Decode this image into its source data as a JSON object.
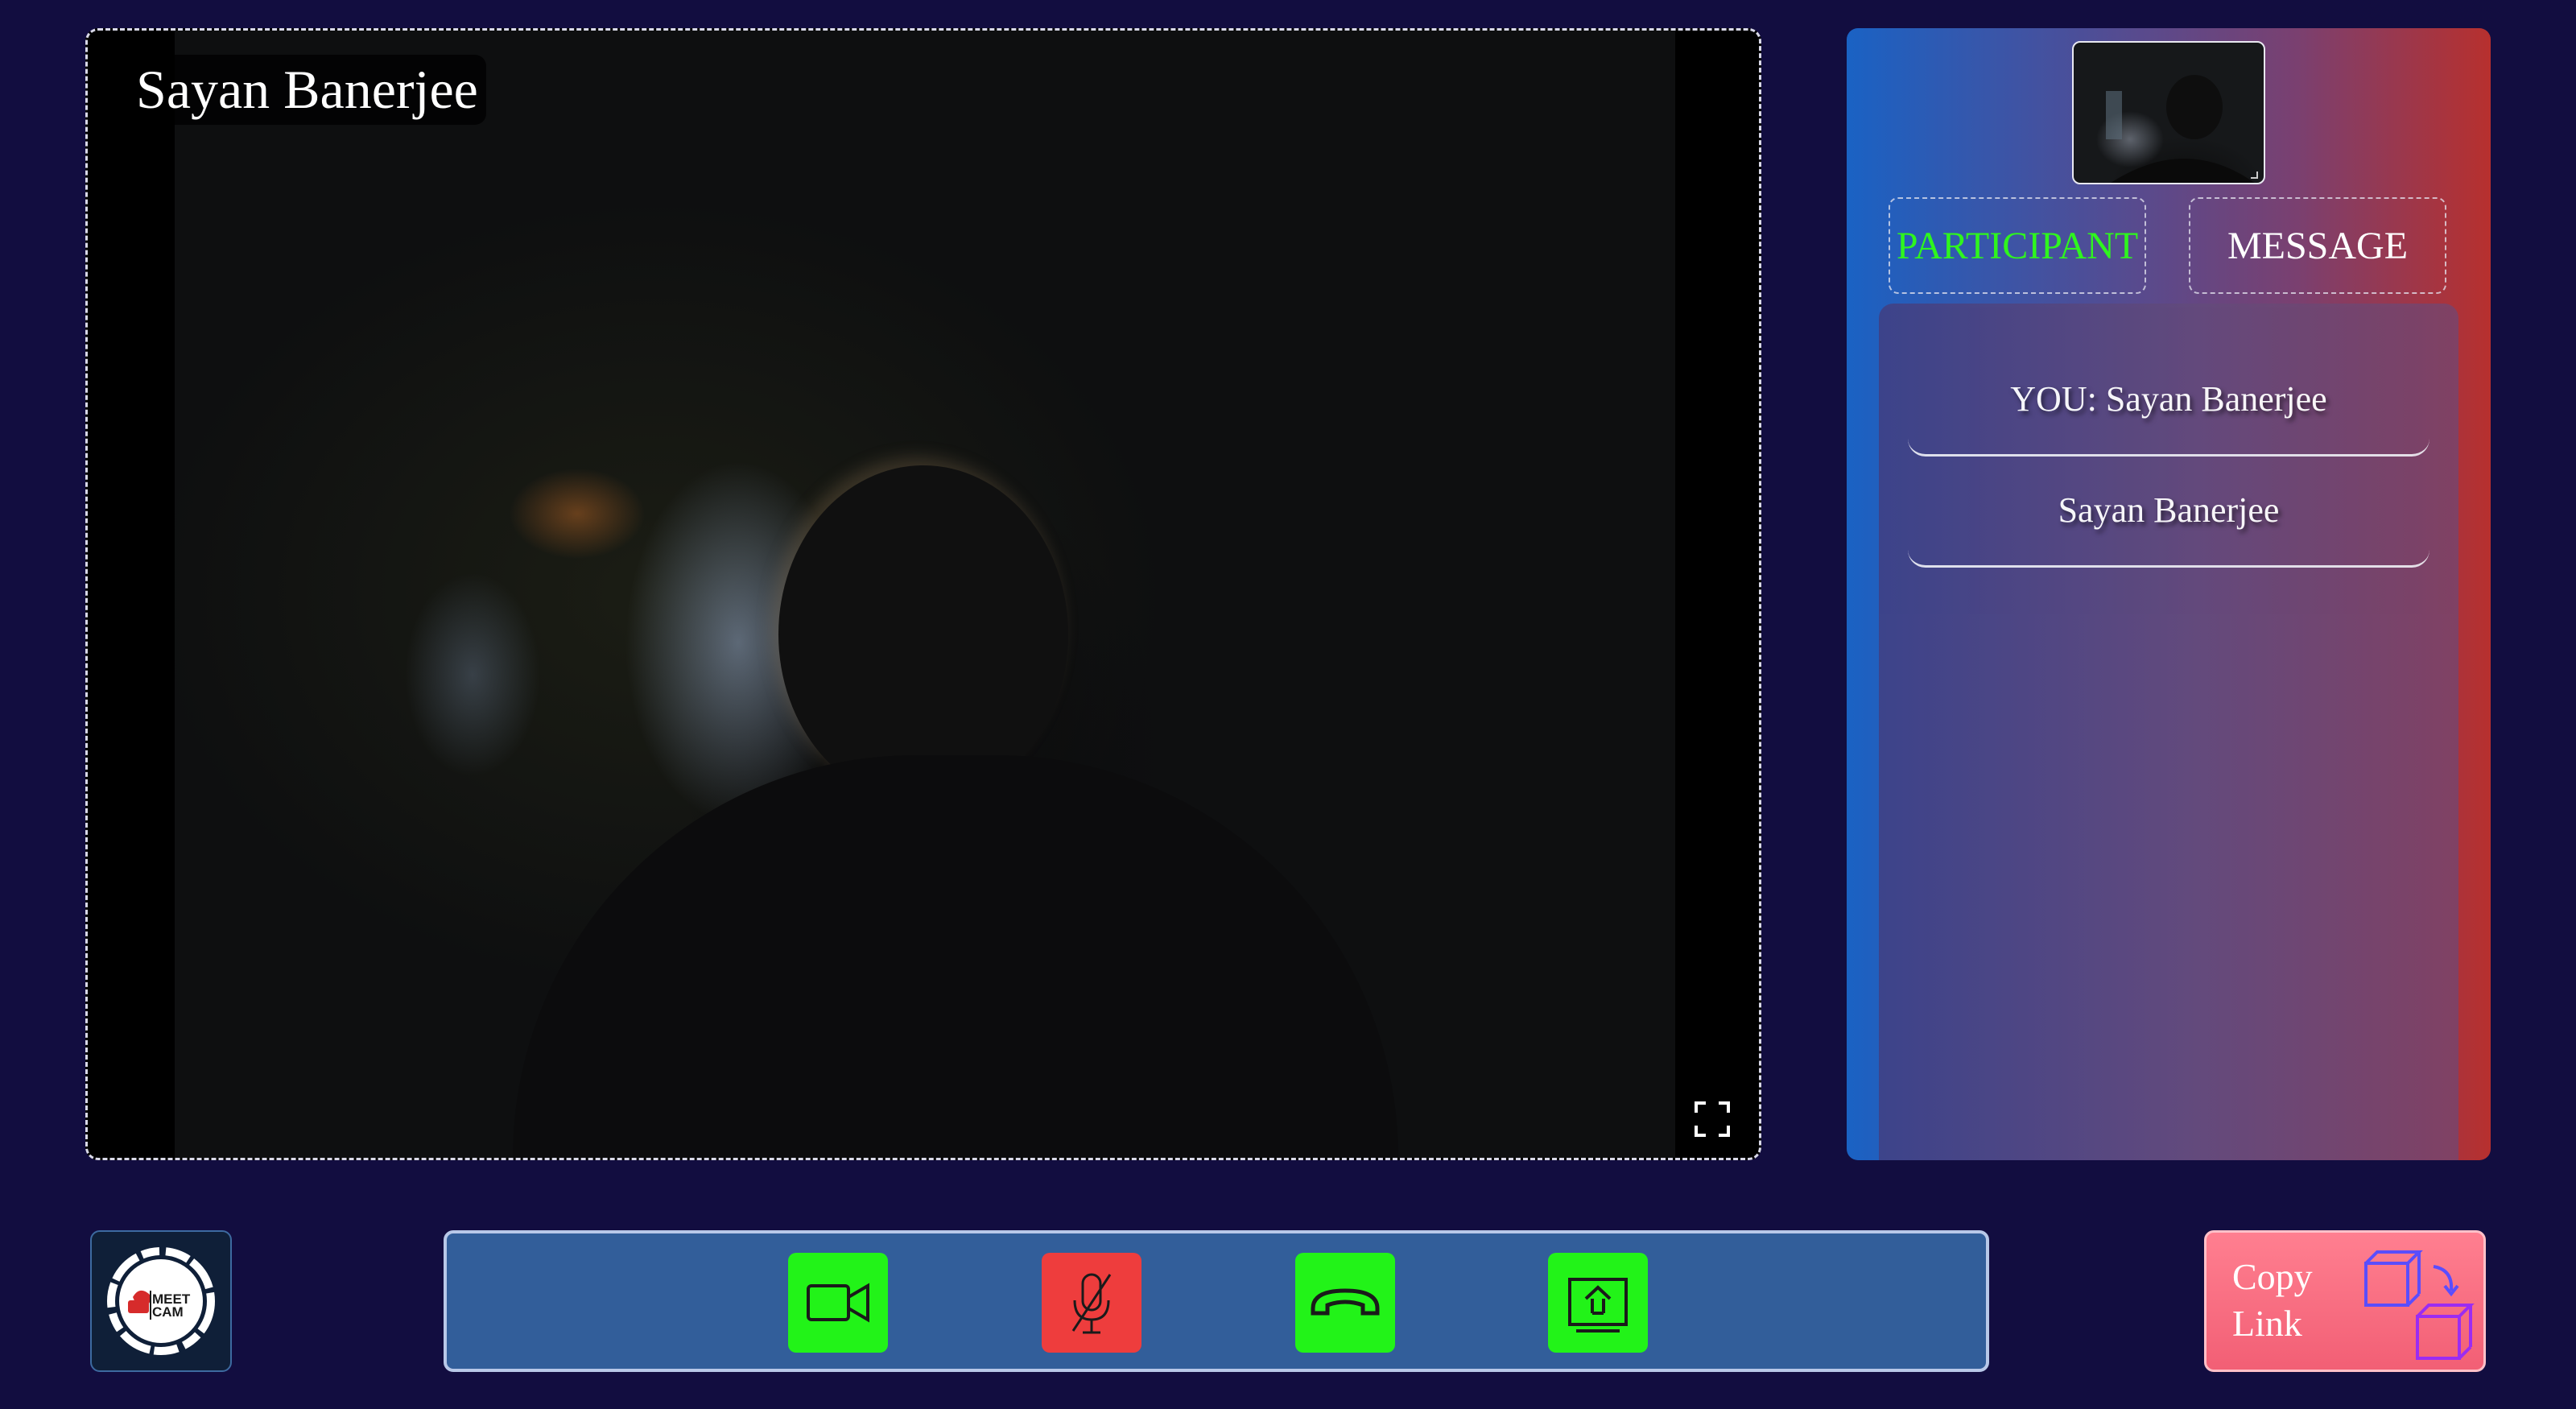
{
  "main_video": {
    "name_tag": "Sayan Banerjee",
    "fullscreen_icon": "fullscreen-icon"
  },
  "side_panel": {
    "tabs": [
      {
        "label": "PARTICIPANT",
        "active": true,
        "color": "#2ff51e"
      },
      {
        "label": "MESSAGE",
        "active": false,
        "color": "#ffffff"
      }
    ],
    "participants": [
      {
        "label": "YOU: Sayan Banerjee"
      },
      {
        "label": "Sayan Banerjee"
      }
    ]
  },
  "logo": {
    "line1": "MEET",
    "line2": "CAM"
  },
  "controls": {
    "video_icon": "video-camera-icon",
    "mic_icon": "mic-off-icon",
    "hangup_icon": "phone-hangup-icon",
    "share_icon": "screen-share-icon"
  },
  "copy_link": {
    "line1": "Copy",
    "line2": "Link",
    "icon": "copy-icon"
  },
  "colors": {
    "background": "#120d40",
    "control_green": "#22f318",
    "control_red": "#ee3d3d",
    "control_bar": "#325e9a"
  }
}
